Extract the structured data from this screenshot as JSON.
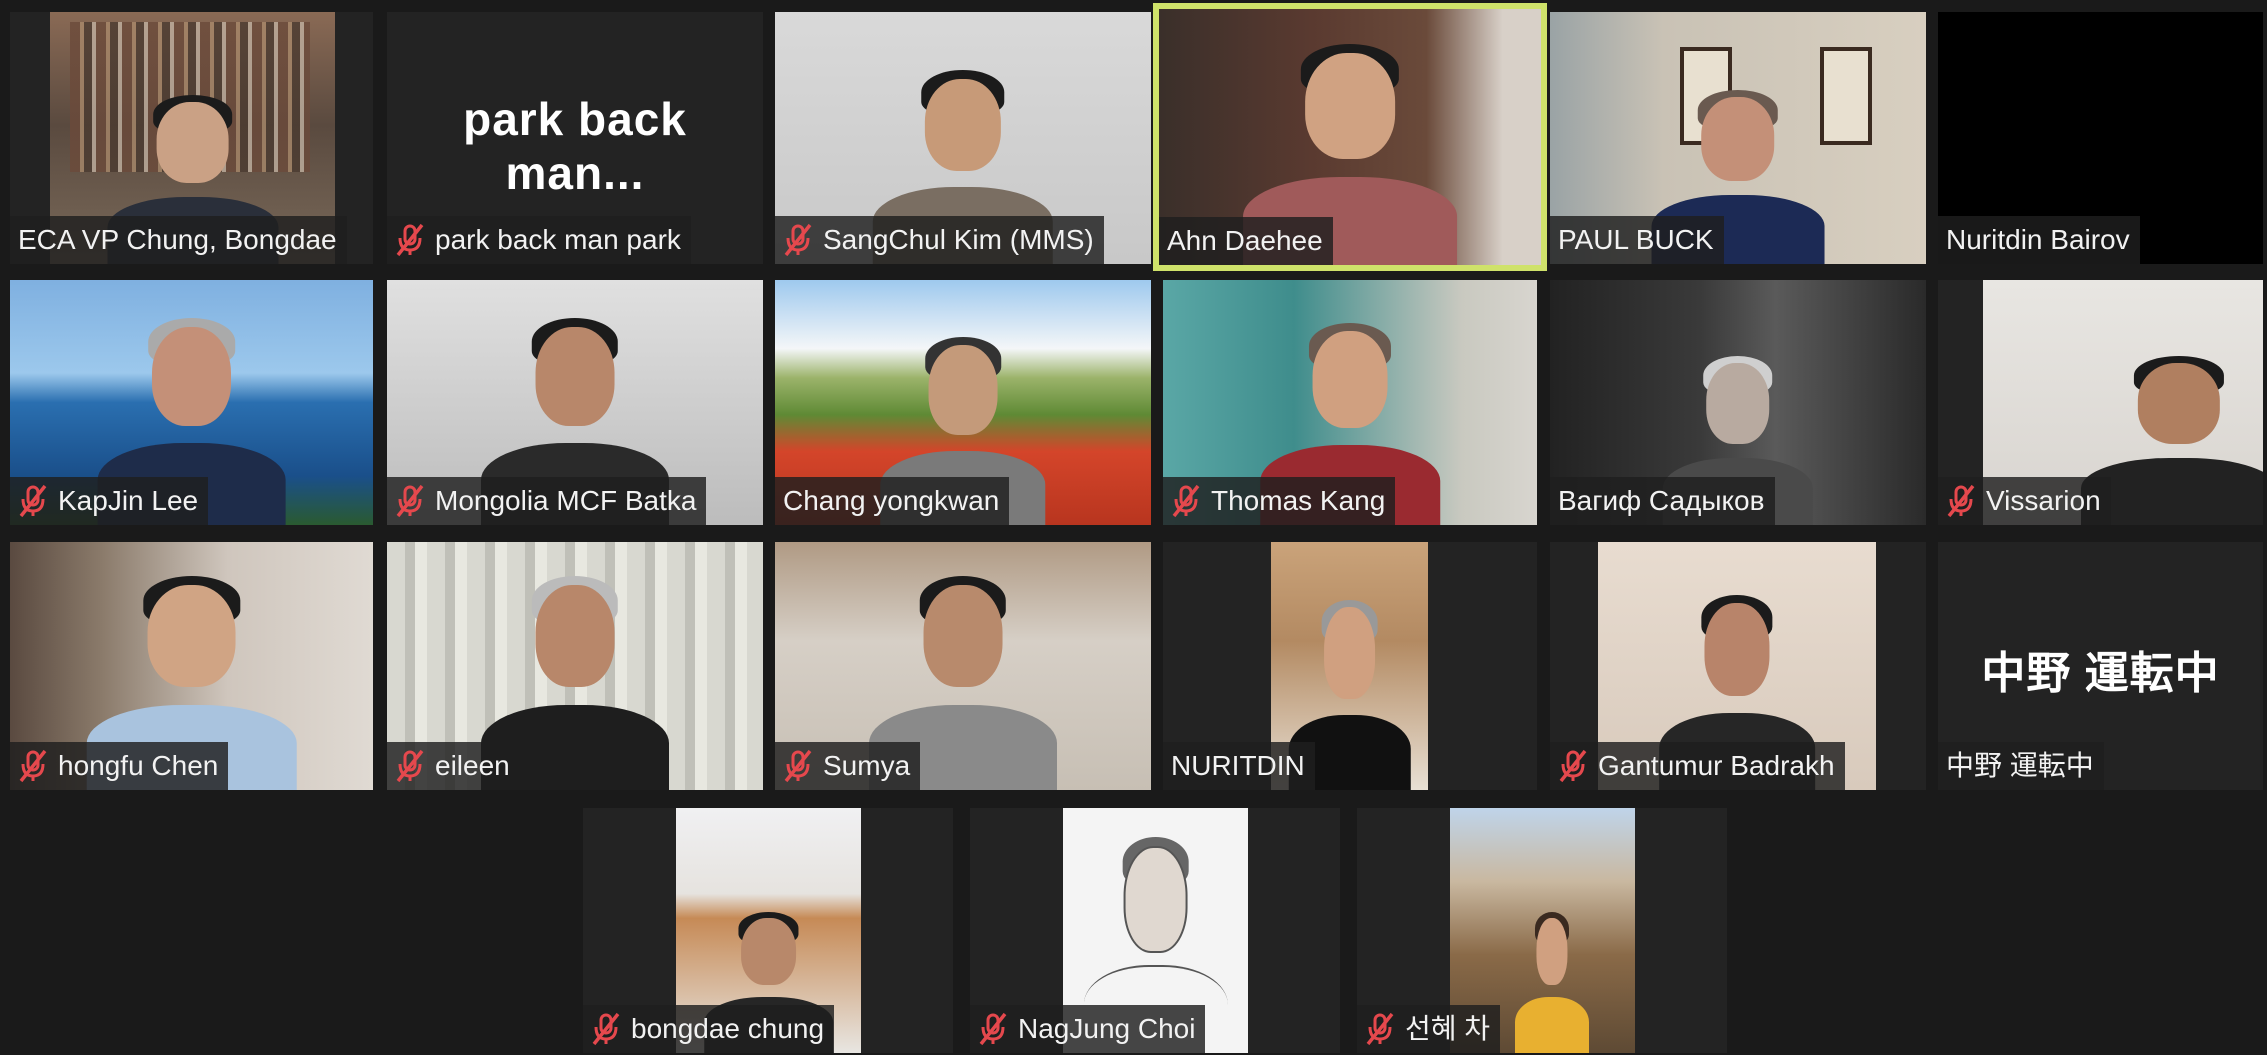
{
  "colors": {
    "active_speaker_border": "#cfe26a",
    "mute_icon": "#e5484d",
    "tile_bg": "#232323"
  },
  "participants": [
    {
      "name": "ECA VP  Chung, Bongdae",
      "muted": false
    },
    {
      "name": "park back man park",
      "muted": true,
      "display_text": "park  back  man..."
    },
    {
      "name": "SangChul Kim (MMS)",
      "muted": true
    },
    {
      "name": "Ahn Daehee",
      "muted": false,
      "active_speaker": true
    },
    {
      "name": "PAUL BUCK",
      "muted": false
    },
    {
      "name": "Nuritdin Bairov",
      "muted": false
    },
    {
      "name": "KapJin Lee",
      "muted": true
    },
    {
      "name": "Mongolia MCF Batka",
      "muted": true
    },
    {
      "name": "Chang yongkwan",
      "muted": false
    },
    {
      "name": "Thomas Kang",
      "muted": true
    },
    {
      "name": "Вагиф Садыков",
      "muted": false
    },
    {
      "name": "Vissarion",
      "muted": true
    },
    {
      "name": "hongfu Chen",
      "muted": true
    },
    {
      "name": "eileen",
      "muted": true
    },
    {
      "name": "Sumya",
      "muted": true
    },
    {
      "name": "NURITDIN",
      "muted": false
    },
    {
      "name": "Gantumur Badrakh",
      "muted": true
    },
    {
      "name": "中野 運転中",
      "muted": false,
      "display_text": "中野  運転中"
    },
    {
      "name": "bongdae chung",
      "muted": true
    },
    {
      "name": "NagJung Choi",
      "muted": true
    },
    {
      "name": "선혜 차",
      "muted": true
    }
  ]
}
